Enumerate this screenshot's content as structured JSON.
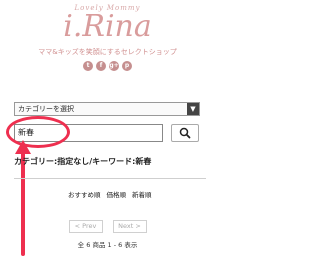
{
  "header": {
    "tagline": "Lovely Mommy",
    "logo": "i.Rina",
    "subtitle": "ママ&キッズを笑顔にするセレクトショップ",
    "social_icons": [
      {
        "icon": "twitter-icon",
        "glyph": "t"
      },
      {
        "icon": "facebook-icon",
        "glyph": "f"
      },
      {
        "icon": "google-plus-icon",
        "glyph": "g+"
      },
      {
        "icon": "pinterest-icon",
        "glyph": "p"
      }
    ]
  },
  "search": {
    "category_select": "カテゴリーを選択",
    "keyword_value": "新春",
    "search_icon": "search-icon"
  },
  "annotation": {
    "color": "#ee2f4f"
  },
  "results": {
    "condition": "カテゴリー:指定なし/キーワード:新春",
    "sort_options": [
      "おすすめ順",
      "価格順",
      "新着順"
    ],
    "prev_label": "< Prev",
    "next_label": "Next >",
    "count_text": "全 6 商品  1 - 6 表示"
  },
  "colors": {
    "brand_pink": "#d99c9c",
    "accent_red": "#ee2f4f"
  }
}
